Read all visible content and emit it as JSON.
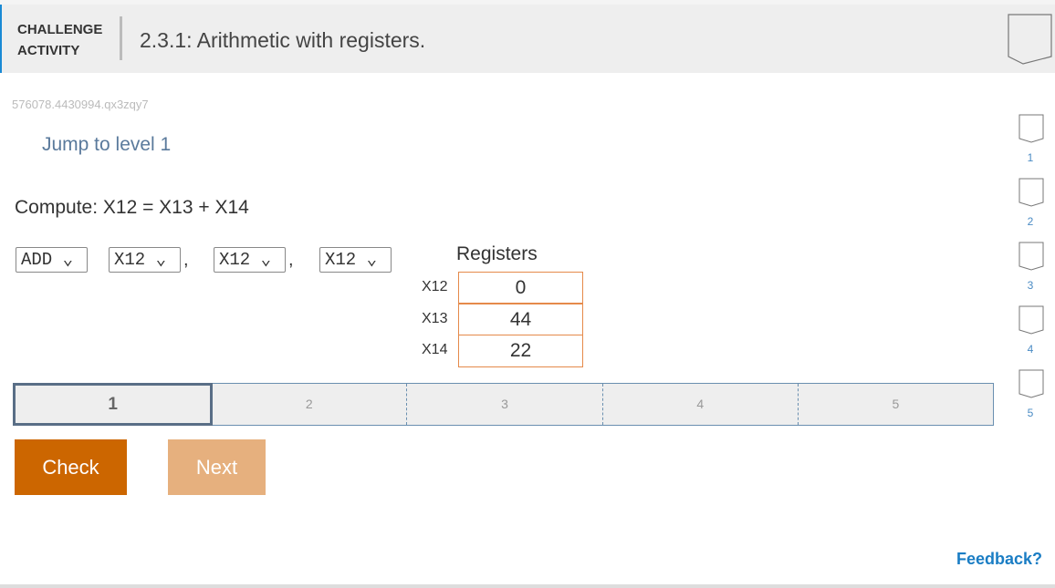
{
  "header": {
    "label_line1": "CHALLENGE",
    "label_line2": "ACTIVITY",
    "title": "2.3.1: Arithmetic with registers."
  },
  "activity_id": "576078.4430994.qx3zqy7",
  "jump_link": "Jump to level 1",
  "prompt": "Compute: X12 = X13 + X14",
  "instruction": {
    "opcode": "ADD",
    "operands": [
      "X12",
      "X12",
      "X12"
    ],
    "separator": ","
  },
  "registers": {
    "title": "Registers",
    "rows": [
      {
        "name": "X12",
        "value": "0"
      },
      {
        "name": "X13",
        "value": "44"
      },
      {
        "name": "X14",
        "value": "22"
      }
    ]
  },
  "levels": [
    "1",
    "2",
    "3",
    "4",
    "5"
  ],
  "current_level": "1",
  "side_levels": [
    "1",
    "2",
    "3",
    "4",
    "5"
  ],
  "buttons": {
    "check": "Check",
    "next": "Next"
  },
  "feedback": "Feedback?",
  "colors": {
    "check": "#cc6600",
    "next": "#e6b07e",
    "accent": "#1a8ad4"
  }
}
